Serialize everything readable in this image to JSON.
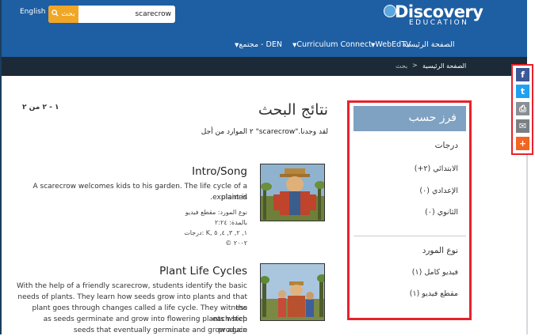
{
  "header": {
    "language_link": "English",
    "search": {
      "button_label": "بحث",
      "value": "scarecrow"
    },
    "logo": {
      "brand": "Discovery",
      "sub": "EDUCATION"
    },
    "nav": [
      {
        "label": "الصفحة الرئيسية"
      },
      {
        "label": "WebEdTV"
      },
      {
        "label": "Curriculum Connect"
      },
      {
        "label": "مجتمع - DEN"
      }
    ]
  },
  "breadcrumb": {
    "home": "الصفحة الرئيسية",
    "separator": ">",
    "current": "بحث"
  },
  "share": {
    "items": [
      {
        "icon": "facebook-icon",
        "glyph": "f",
        "color": "#3b5998"
      },
      {
        "icon": "twitter-icon",
        "glyph": "t",
        "color": "#1da1f2"
      },
      {
        "icon": "print-icon",
        "glyph": "⎙",
        "color": "#8a8f94"
      },
      {
        "icon": "email-icon",
        "glyph": "✉",
        "color": "#7a7f84"
      },
      {
        "icon": "plus-icon",
        "glyph": "+",
        "color": "#f26522"
      }
    ]
  },
  "sort": {
    "title": "فرز حسب",
    "grades_heading": "درجات",
    "grades": [
      {
        "label": "الابتدائي (٢+)"
      },
      {
        "label": "الإعدادي (٠)"
      },
      {
        "label": "الثانوي (٠)"
      }
    ],
    "resource_heading": "نوع المورد",
    "resource_types": [
      {
        "label": "فيديو كامل (١)"
      },
      {
        "label": "مقطع فيديو (١)"
      }
    ]
  },
  "results": {
    "title": "نتائج البحث",
    "count_text": "٢ الموارد من أجل \"scarecrow\".لقد وجدنا",
    "pager": "١ - ٢ من ٢",
    "items": [
      {
        "title": "Intro/Song",
        "desc_lines": [
          "A scarecrow welcomes kids to his garden. The life cycle of a plant is",
          ".explained"
        ],
        "type": "نوع المورد: مقطع فيديو",
        "duration": "بالمدة: ٢:٢٤",
        "grades": "درجات: K, ١, ٢, ٣, ٤, ٥",
        "year": "© ٢٠٠٢"
      },
      {
        "title": "Plant Life Cycles",
        "desc_lines": [
          "With the help of a friendly scarecrow, students identify the basic",
          "needs of plants. They learn how seeds grow into plants and that the",
          "plant goes through changes called a life cycle. They witness each step",
          "as seeds germinate and grow into flowering plants which produce",
          "seeds that eventually germinate and grow again"
        ]
      }
    ]
  },
  "colors": {
    "header_blue": "#1e5ea2",
    "subbar": "#1b2a36",
    "panel_head": "#7fa1c2",
    "highlight_red": "#e8222b",
    "search_orange": "#f0a626"
  }
}
